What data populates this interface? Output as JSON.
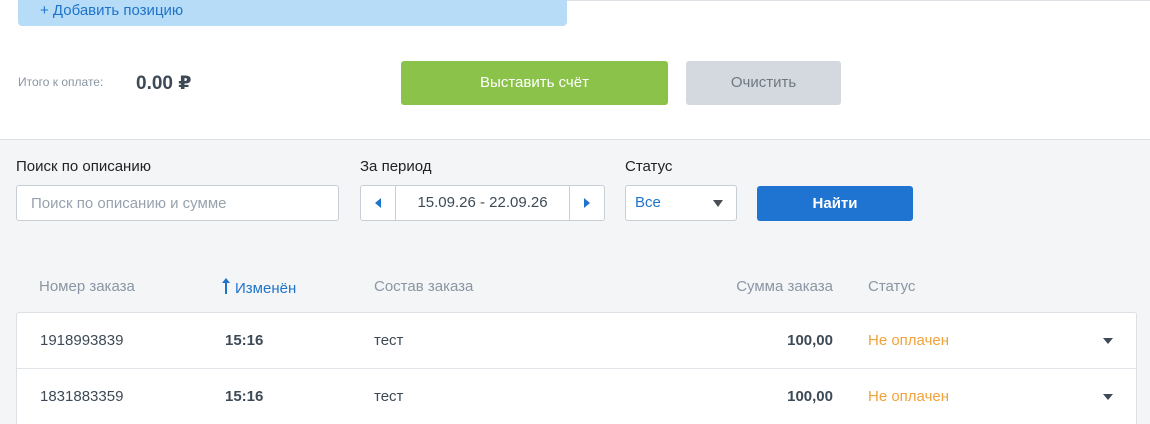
{
  "add_position_label": "+ Добавить позицию",
  "total": {
    "label": "Итого к оплате:",
    "value": "0.00 ₽"
  },
  "actions": {
    "issue_label": "Выставить счёт",
    "clear_label": "Очистить"
  },
  "filters": {
    "search_label": "Поиск по описанию",
    "search_placeholder": "Поиск по описанию и сумме",
    "search_value": "",
    "period_label": "За период",
    "period_value": "15.09.26 - 22.09.26",
    "status_label": "Статус",
    "status_value": "Все",
    "find_label": "Найти"
  },
  "table": {
    "headers": {
      "number": "Номер заказа",
      "changed": "Изменён",
      "composition": "Состав заказа",
      "sum": "Сумма заказа",
      "status": "Статус"
    },
    "sort_icon": "arrow-up-icon",
    "rows": [
      {
        "number": "1918993839",
        "time": "15:16",
        "composition": "тест",
        "sum": "100,00",
        "status": "Не оплачен"
      },
      {
        "number": "1831883359",
        "time": "15:16",
        "composition": "тест",
        "sum": "100,00",
        "status": "Не оплачен"
      }
    ]
  },
  "colors": {
    "accent": "#1f74d2",
    "issue_button": "#8bc34a",
    "clear_button": "#d3d9de",
    "add_button": "#b7dcf8",
    "status_unpaid": "#f0a23b"
  }
}
